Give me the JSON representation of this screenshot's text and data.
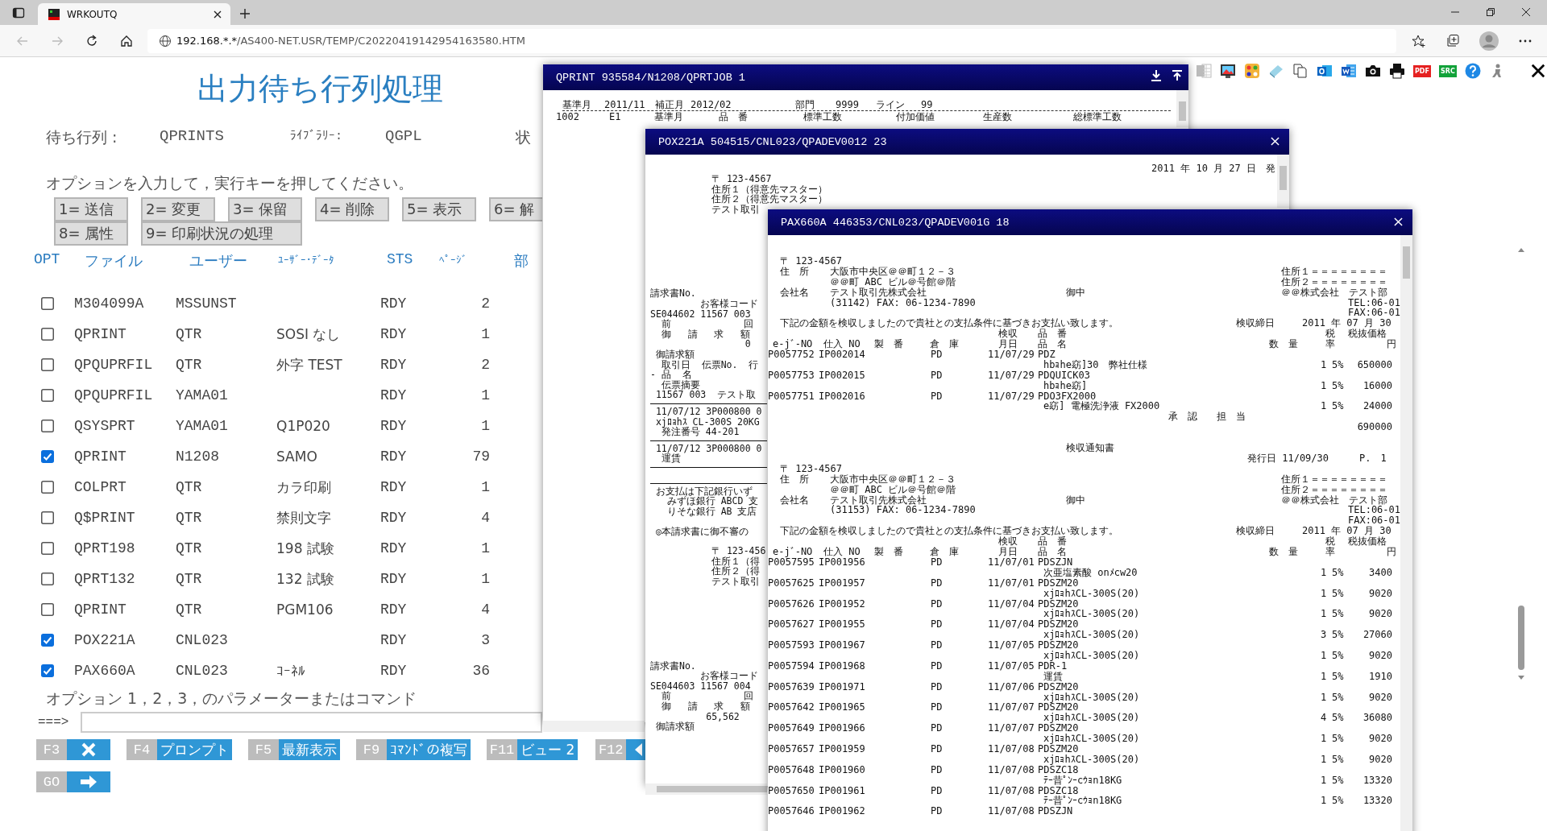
{
  "browser": {
    "tab": {
      "title": "WRKOUTQ"
    },
    "url": {
      "host": "192.168.*.*",
      "path": "/AS400-NET.USR/TEMP/C20220419142954163580.HTM"
    }
  },
  "page": {
    "title": "出力待ち行列処理",
    "queue": {
      "label": "待ち行列 :",
      "value": "QPRINTS",
      "library_label": "ﾗｲﾌﾞﾗﾘｰ:",
      "library": "QGPL",
      "status_label": "状"
    },
    "instruction": "オプションを入力して，実行キーを押してください。",
    "options": [
      [
        "1=  送信",
        "2=  変更",
        "3=  保留",
        "4=  削除",
        "5=  表示",
        "6=  解"
      ],
      [
        "8=  属性",
        "9=  印刷状況の処理"
      ]
    ],
    "columns": [
      "OPT",
      "ファイル",
      "ユーザー",
      "ﾕｰｻﾞｰ･ﾃﾞｰﾀ",
      "STS",
      "ﾍﾟｰｼﾞ",
      "部"
    ],
    "rows": [
      {
        "checked": false,
        "file": "M304099A",
        "user": "MSSUNST",
        "status": "RDY",
        "pages": "2"
      },
      {
        "checked": false,
        "file": "QPRINT",
        "user": "QTR",
        "user_data": "SOSI なし",
        "status": "RDY",
        "pages": "1"
      },
      {
        "checked": false,
        "file": "QPQUPRFIL",
        "user": "QTR",
        "user_data": "外字 TEST",
        "status": "RDY",
        "pages": "2"
      },
      {
        "checked": false,
        "file": "QPQUPRFIL",
        "user": "YAMA01",
        "status": "RDY",
        "pages": "1"
      },
      {
        "checked": false,
        "file": "QSYSPRT",
        "user": "YAMA01",
        "user_data": "Q1P020",
        "status": "RDY",
        "pages": "1"
      },
      {
        "checked": true,
        "file": "QPRINT",
        "user": "N1208",
        "user_data": "SAMO",
        "status": "RDY",
        "pages": "79"
      },
      {
        "checked": false,
        "file": "COLPRT",
        "user": "QTR",
        "user_data": "カラ印刷",
        "status": "RDY",
        "pages": "1"
      },
      {
        "checked": false,
        "file": "Q$PRINT",
        "user": "QTR",
        "user_data": "禁則文字",
        "status": "RDY",
        "pages": "4"
      },
      {
        "checked": false,
        "file": "QPRT198",
        "user": "QTR",
        "user_data": "198 試験",
        "status": "RDY",
        "pages": "1"
      },
      {
        "checked": false,
        "file": "QPRT132",
        "user": "QTR",
        "user_data": "132 試験",
        "status": "RDY",
        "pages": "1"
      },
      {
        "checked": false,
        "file": "QPRINT",
        "user": "QTR",
        "user_data": "PGM106",
        "status": "RDY",
        "pages": "4"
      },
      {
        "checked": true,
        "file": "POX221A",
        "user": "CNL023",
        "status": "RDY",
        "pages": "3"
      },
      {
        "checked": true,
        "file": "PAX660A",
        "user": "CNL023",
        "user_data": "ｺｰﾈﾙ",
        "status": "RDY",
        "pages": "36"
      }
    ],
    "command_label": "オプション 1，2，3，のパラメーターまたはコマンド",
    "prompt": "===>",
    "fkeys": [
      {
        "key": "F3",
        "kind": "close"
      },
      {
        "key": "F4",
        "label": "プロンプト"
      },
      {
        "key": "F5",
        "label": "最新表示"
      },
      {
        "key": "F9",
        "label": "ｺﾏﾝﾄﾞの複写"
      },
      {
        "key": "F11",
        "label": "ビュー 2"
      },
      {
        "key": "F12",
        "kind": "back"
      }
    ],
    "go": {
      "key": "GO",
      "kind": "enter"
    }
  },
  "tools": [
    {
      "kind": "spreadsheet"
    },
    {
      "kind": "image"
    },
    {
      "kind": "palette"
    },
    {
      "kind": "note"
    },
    {
      "kind": "copy"
    },
    {
      "kind": "mail"
    },
    {
      "kind": "document"
    },
    {
      "kind": "camera"
    },
    {
      "kind": "printer"
    },
    {
      "kind": "pdf",
      "label": "PDF"
    },
    {
      "kind": "src",
      "label": "SRC"
    },
    {
      "kind": "help"
    },
    {
      "kind": "figure"
    },
    {
      "kind": "close"
    }
  ],
  "qprint": {
    "title": "QPRINT 935584/N1208/QPRTJOB 1",
    "header": [
      "基準月",
      "2011/11",
      "補正月",
      "2012/02",
      "部門",
      "9999",
      "ライン",
      "99"
    ],
    "row": [
      "1002",
      "E1",
      "基準月",
      "品　番",
      "標準工数",
      "付加価値",
      "生産数",
      "総標準工数"
    ]
  },
  "pox": {
    "title": "POX221A 504515/CNL023/QPADEV0012 23",
    "date": "2011 年 10 月 27 日　発",
    "sections": [
      {
        "kind": "address",
        "lines": [
          "〒 123-4567",
          "住所１（得意先マスター）",
          "住所２（得意先マスター）",
          "テスト取引"
        ]
      },
      {
        "kind": "gap"
      },
      {
        "kind": "text",
        "lines": [
          "請求書No.",
          "         お客様コード",
          "SE044602 11567 003",
          "  前             回",
          "  御   請   求   額",
          "                 0",
          " 御請求額",
          "  取引日  伝票No.  行",
          "- 品  名",
          "  伝票摘要",
          " 11567 003  テスト取"
        ]
      },
      {
        "kind": "rule"
      },
      {
        "kind": "text",
        "lines": [
          " 11/07/12 3P000800 0",
          " xjﾛｮhｽ CL-300S 20KG",
          "  発注番号 44-201"
        ]
      },
      {
        "kind": "rule"
      },
      {
        "kind": "text",
        "lines": [
          " 11/07/12 3P000800 0",
          "  運賃"
        ]
      },
      {
        "kind": "rule"
      },
      {
        "kind": "blank"
      },
      {
        "kind": "rule"
      },
      {
        "kind": "text",
        "lines": [
          " お支払は下記銀行いず",
          "   みずほ銀行 ABCD 支",
          "   りそな銀行 AB 支店"
        ]
      },
      {
        "kind": "blank"
      },
      {
        "kind": "text",
        "lines": [
          " ◎本請求書に御不審の"
        ]
      },
      {
        "kind": "blank"
      },
      {
        "kind": "address",
        "lines": [
          "〒 123-456",
          "住所１（得",
          "住所２（得",
          "テスト取引"
        ]
      },
      {
        "kind": "gap"
      },
      {
        "kind": "text",
        "lines": [
          "請求書No.",
          "         お客様コード",
          "SE044603 11567 004",
          "  前             回",
          "  御   請   求   額",
          "          65,562",
          " 御請求額"
        ]
      }
    ]
  },
  "pax": {
    "title": "PAX660A 446353/CNL023/QPADEV001G 18",
    "documents": [
      {
        "address": {
          "postal": "〒 123-4567",
          "address_label": "住　所",
          "lines": [
            "大阪市中央区＠＠町１２－３",
            "＠＠町 ABC ビル＠号館＠階"
          ],
          "company_label": "会社名",
          "company": "テスト取引先株式会社",
          "honorific": "御中",
          "fax": "(31142) FAX: 06-1234-7890",
          "sender": [
            "住所１＝＝＝＝＝＝＝＝",
            "住所２＝＝＝＝＝＝＝＝",
            "＠＠株式会社　テスト部",
            "TEL:06-01",
            "FAX:06-01"
          ]
        },
        "notice": {
          "text": "下記の金額を検収しましたので貴社との支払条件に基づきお支払い致します。",
          "closing_label": "検収締日",
          "closing_date": "2011 年 07 月 30"
        },
        "columns": {
          "top": [
            "検収",
            "品　番",
            "税",
            "税抜価格"
          ],
          "bottom": [
            "e-jﾞ-NO",
            "仕入 NO",
            "製　番",
            "倉　庫",
            "月日",
            "品　名",
            "数　量",
            "率",
            "円"
          ]
        },
        "items": [
          {
            "order": "P0057752",
            "purchase": "IP002014",
            "warehouse": "PD",
            "date": "11/07/29",
            "code": "PDZ",
            "name": "hbｮhe窈]30　弊社仕様",
            "qty": "1",
            "rate": "5%",
            "amount": "650000"
          },
          {
            "order": "P0057753",
            "purchase": "IP002015",
            "warehouse": "PD",
            "date": "11/07/29",
            "code": "PDQUICK03",
            "name": "hbｮhe窈]",
            "qty": "1",
            "rate": "5%",
            "amount": "16000"
          },
          {
            "order": "P0057751",
            "purchase": "IP002016",
            "warehouse": "PD",
            "date": "11/07/29",
            "code": "PDO3FX2000",
            "name": "e窈] 電極洗浄液 FX2000",
            "qty": "1",
            "rate": "5%",
            "amount": "24000"
          }
        ],
        "approval": "承　認　　担　当",
        "total": "690000"
      },
      {
        "heading": {
          "title": "検収通知書",
          "issued": "発行日 11/09/30",
          "page": "P.　1"
        },
        "address": {
          "postal": "〒 123-4567",
          "address_label": "住　所",
          "lines": [
            "大阪市中央区＠＠町１２－３",
            "＠＠町 ABC ビル＠号館＠階"
          ],
          "company_label": "会社名",
          "company": "テスト取引先株式会社",
          "honorific": "御中",
          "fax": "(31153) FAX: 06-1234-7890",
          "sender": [
            "住所１＝＝＝＝＝＝＝＝",
            "住所２＝＝＝＝＝＝＝＝",
            "＠＠株式会社　テスト部",
            "TEL:06-01",
            "FAX:06-01"
          ]
        },
        "notice": {
          "text": "下記の金額を検収しましたので貴社との支払条件に基づきお支払い致します。",
          "closing_label": "検収締日",
          "closing_date": "2011 年 07 月 30"
        },
        "columns": {
          "top": [
            "検収",
            "品　番",
            "税",
            "税抜価格"
          ],
          "bottom": [
            "e-jﾞ-NO",
            "仕入 NO",
            "製　番",
            "倉　庫",
            "月日",
            "品　名",
            "数　量",
            "率",
            "円"
          ]
        },
        "items": [
          {
            "order": "P0057595",
            "purchase": "IP001956",
            "warehouse": "PD",
            "date": "11/07/01",
            "code": "PDSZJN",
            "name": "次亜塩素酸 onﾒcw20",
            "qty": "1",
            "rate": "5%",
            "amount": "3400"
          },
          {
            "order": "P0057625",
            "purchase": "IP001957",
            "warehouse": "PD",
            "date": "11/07/01",
            "code": "PDSZM20",
            "name": "xjﾛｮhｽCL-300S(20)",
            "qty": "1",
            "rate": "5%",
            "amount": "9020"
          },
          {
            "order": "P0057626",
            "purchase": "IP001952",
            "warehouse": "PD",
            "date": "11/07/04",
            "code": "PDSZM20",
            "name": "xjﾛｮhｽCL-300S(20)",
            "qty": "1",
            "rate": "5%",
            "amount": "9020"
          },
          {
            "order": "P0057627",
            "purchase": "IP001955",
            "warehouse": "PD",
            "date": "11/07/04",
            "code": "PDSZM20",
            "name": "xjﾛｮhｽCL-300S(20)",
            "qty": "3",
            "rate": "5%",
            "amount": "27060"
          },
          {
            "order": "P0057593",
            "purchase": "IP001967",
            "warehouse": "PD",
            "date": "11/07/05",
            "code": "PDSZM20",
            "name": "xjﾛｮhｽCL-300S(20)",
            "qty": "1",
            "rate": "5%",
            "amount": "9020"
          },
          {
            "order": "P0057594",
            "purchase": "IP001968",
            "warehouse": "PD",
            "date": "11/07/05",
            "code": "PDR-1",
            "name": "運賃",
            "qty": "1",
            "rate": "5%",
            "amount": "1910"
          },
          {
            "order": "P0057639",
            "purchase": "IP001971",
            "warehouse": "PD",
            "date": "11/07/06",
            "code": "PDSZM20",
            "name": "xjﾛｮhｽCL-300S(20)",
            "qty": "1",
            "rate": "5%",
            "amount": "9020"
          },
          {
            "order": "P0057642",
            "purchase": "IP001965",
            "warehouse": "PD",
            "date": "11/07/07",
            "code": "PDSZM20",
            "name": "xjﾛｮhｽCL-300S(20)",
            "qty": "4",
            "rate": "5%",
            "amount": "36080"
          },
          {
            "order": "P0057649",
            "purchase": "IP001966",
            "warehouse": "PD",
            "date": "11/07/07",
            "code": "PDSZM20",
            "name": "xjﾛｮhｽCL-300S(20)",
            "qty": "1",
            "rate": "5%",
            "amount": "9020"
          },
          {
            "order": "P0057657",
            "purchase": "IP001959",
            "warehouse": "PD",
            "date": "11/07/08",
            "code": "PDSZM20",
            "name": "xjﾛｮhｽCL-300S(20)",
            "qty": "1",
            "rate": "5%",
            "amount": "9020"
          },
          {
            "order": "P0057648",
            "purchase": "IP001960",
            "warehouse": "PD",
            "date": "11/07/08",
            "code": "PDSZC18",
            "name": "ﾃｰ昔ﾟﾝｰcｳｮn18KG",
            "qty": "1",
            "rate": "5%",
            "amount": "13320"
          },
          {
            "order": "P0057650",
            "purchase": "IP001961",
            "warehouse": "PD",
            "date": "11/07/08",
            "code": "PDSZC18",
            "name": "ﾃｰ昔ﾟﾝｰcｳｮn18KG",
            "qty": "1",
            "rate": "5%",
            "amount": "13320"
          },
          {
            "order": "P0057646",
            "purchase": "IP001962",
            "warehouse": "PD",
            "date": "11/07/08",
            "code": "PDSZJN"
          }
        ]
      }
    ]
  }
}
